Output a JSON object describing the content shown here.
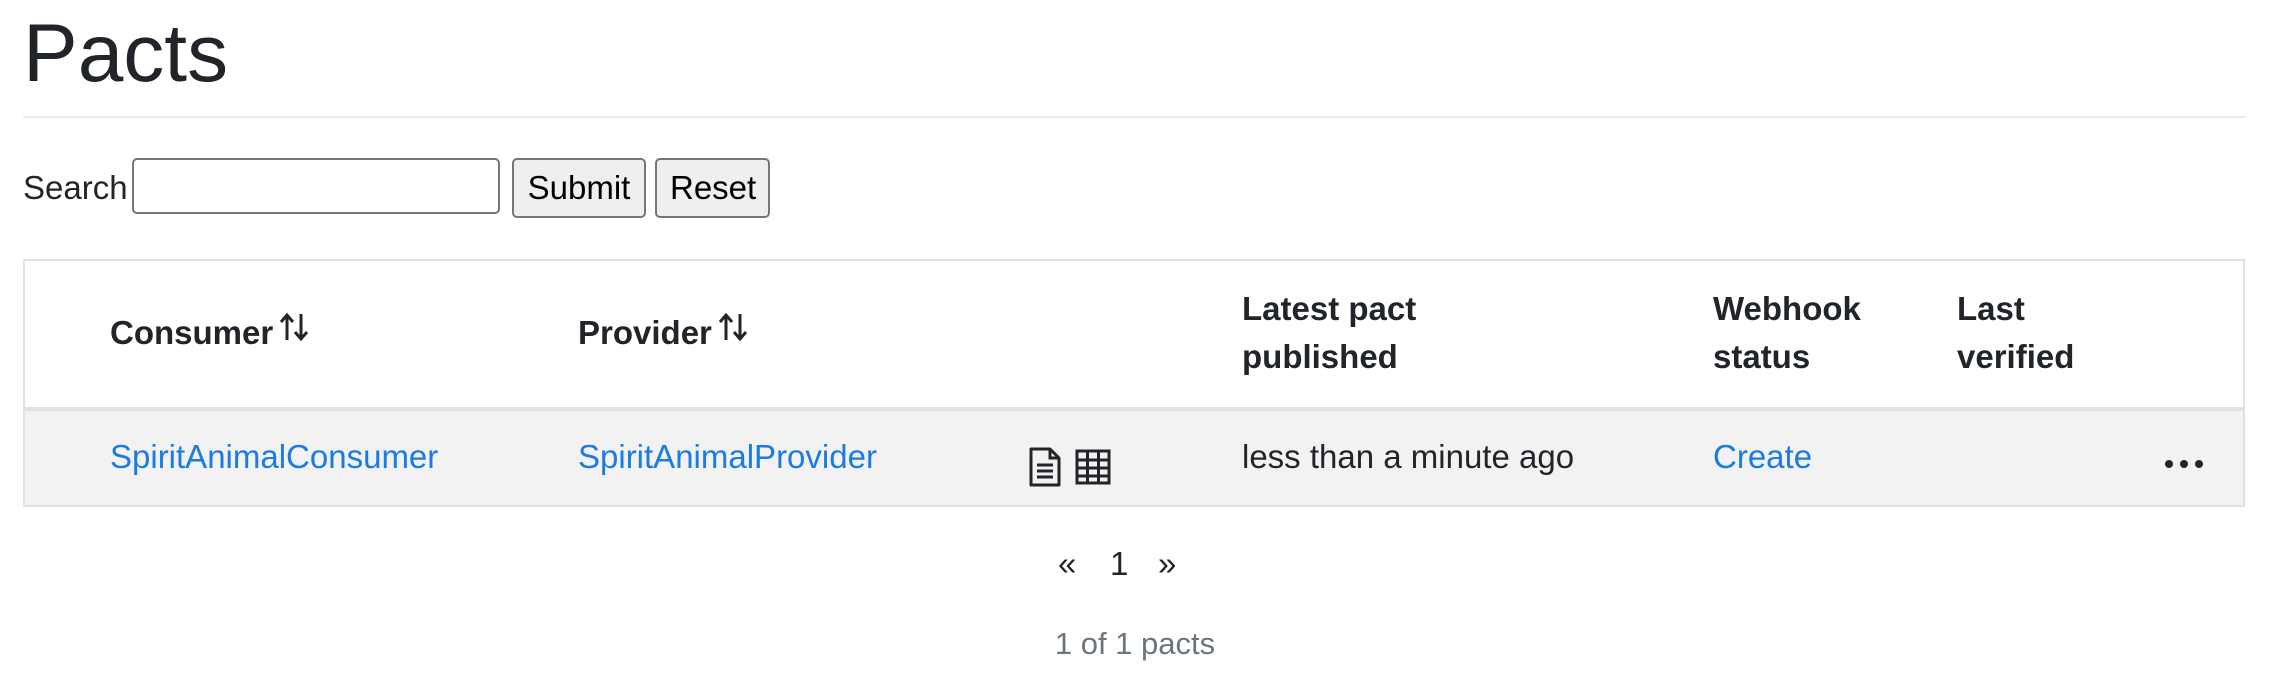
{
  "page": {
    "title": "Pacts"
  },
  "search": {
    "label": "Search",
    "value": "",
    "placeholder": "",
    "submit_label": "Submit",
    "reset_label": "Reset"
  },
  "table": {
    "headers": {
      "consumer": "Consumer",
      "provider": "Provider",
      "latest_pact_published_line1": "Latest pact",
      "latest_pact_published_line2": "published",
      "webhook_status_line1": "Webhook",
      "webhook_status_line2": "status",
      "last_verified_line1": "Last",
      "last_verified_line2": "verified"
    },
    "rows": [
      {
        "consumer": "SpiritAnimalConsumer",
        "provider": "SpiritAnimalProvider",
        "latest_pact_published": "less than a minute ago",
        "webhook_status": "Create",
        "last_verified": "",
        "actions": "more-options"
      }
    ]
  },
  "icons": {
    "sort": "sort-arrows-icon",
    "pact_document": "document-icon",
    "pact_matrix": "table-grid-icon",
    "more": "ellipsis-icon"
  },
  "pagination": {
    "prev": "«",
    "page": "1",
    "next": "»",
    "summary": "1 of 1 pacts"
  },
  "colors": {
    "link": "#1b7be4",
    "text": "#212529",
    "muted": "#6c757d",
    "row_bg": "#f2f2f2"
  }
}
